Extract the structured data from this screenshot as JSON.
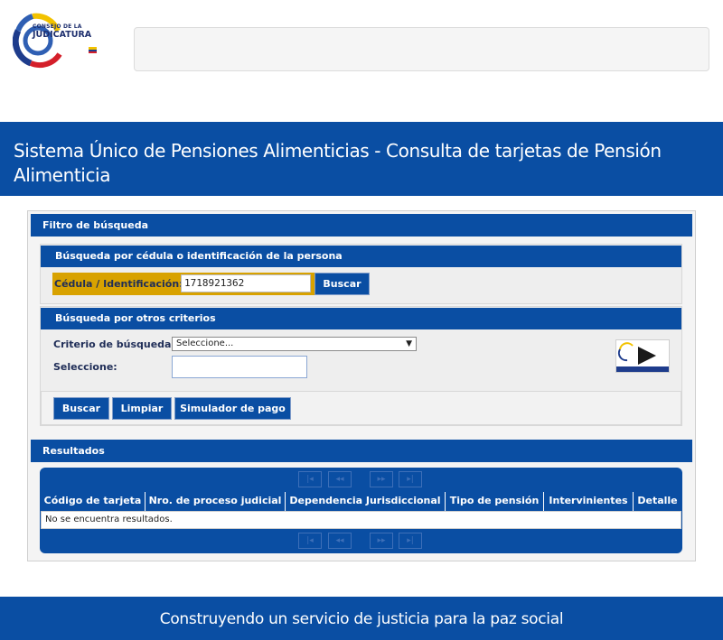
{
  "header": {
    "logo_line1": "CONSEJO DE LA",
    "logo_line2": "JUDICATURA"
  },
  "page_title": "Sistema Único de Pensiones Alimenticias - Consulta de tarjetas de Pensión Alimenticia",
  "filter": {
    "title": "Filtro de búsqueda",
    "by_id": {
      "title": "Búsqueda por cédula o identificación de la persona",
      "label": "Cédula / Identificación:",
      "value": "1718921362",
      "button": "Buscar"
    },
    "by_criteria": {
      "title": "Búsqueda por otros criterios",
      "criterio_label": "Criterio de búsqueda:",
      "criterio_value": "Seleccione...",
      "seleccione_label": "Seleccione:",
      "buttons": {
        "buscar": "Buscar",
        "limpiar": "Limpiar",
        "simulador": "Simulador de pago"
      }
    }
  },
  "results": {
    "title": "Resultados",
    "columns": [
      "Código de tarjeta",
      "Nro. de proceso judicial",
      "Dependencia Jurisdiccional",
      "Tipo de pensión",
      "Intervinientes",
      "Detalle"
    ],
    "empty_message": "No se encuentra resultados.",
    "pager": {
      "first": "|◂",
      "prev": "◂◂",
      "next": "▸▸",
      "last": "▸|"
    }
  },
  "footer": {
    "text": "Construyendo un servicio de justicia para la paz social"
  },
  "colors": {
    "primary_blue": "#0a4ea3",
    "accent_gold": "#d8a200"
  }
}
